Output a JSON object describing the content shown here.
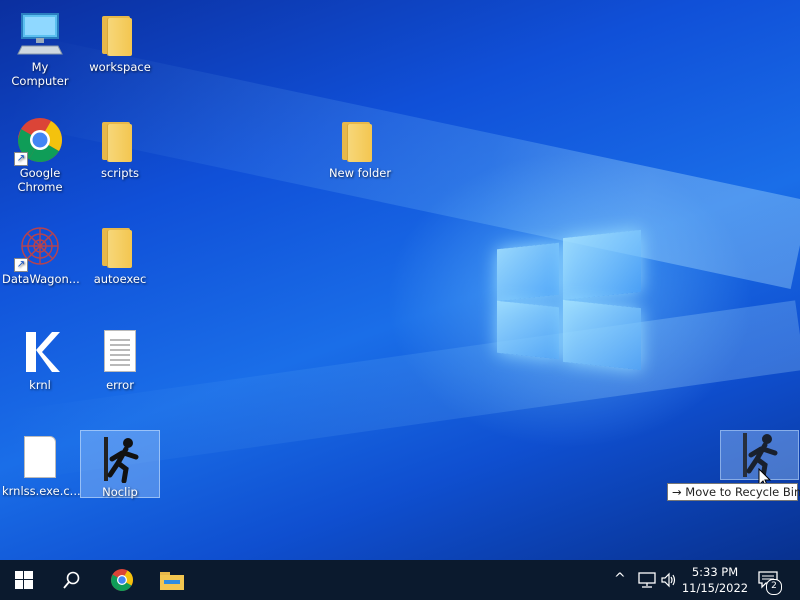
{
  "desktop": {
    "icons": {
      "my_computer": "My Computer",
      "workspace": "workspace",
      "google_chrome": "Google Chrome",
      "scripts": "scripts",
      "new_folder": "New folder",
      "datawagon": "DataWagon...",
      "autoexec": "autoexec",
      "krnl": "krnl",
      "error": "error",
      "krnlss": "krnlss.exe.c...",
      "noclip": "Noclip"
    },
    "drag_tooltip": "Move to Recycle Bin"
  },
  "taskbar": {
    "time": "5:33 PM",
    "date": "11/15/2022",
    "notification_count": "2"
  },
  "colors": {
    "desktop_accent": "#1a6ee8",
    "taskbar": "#0b1a2e"
  }
}
